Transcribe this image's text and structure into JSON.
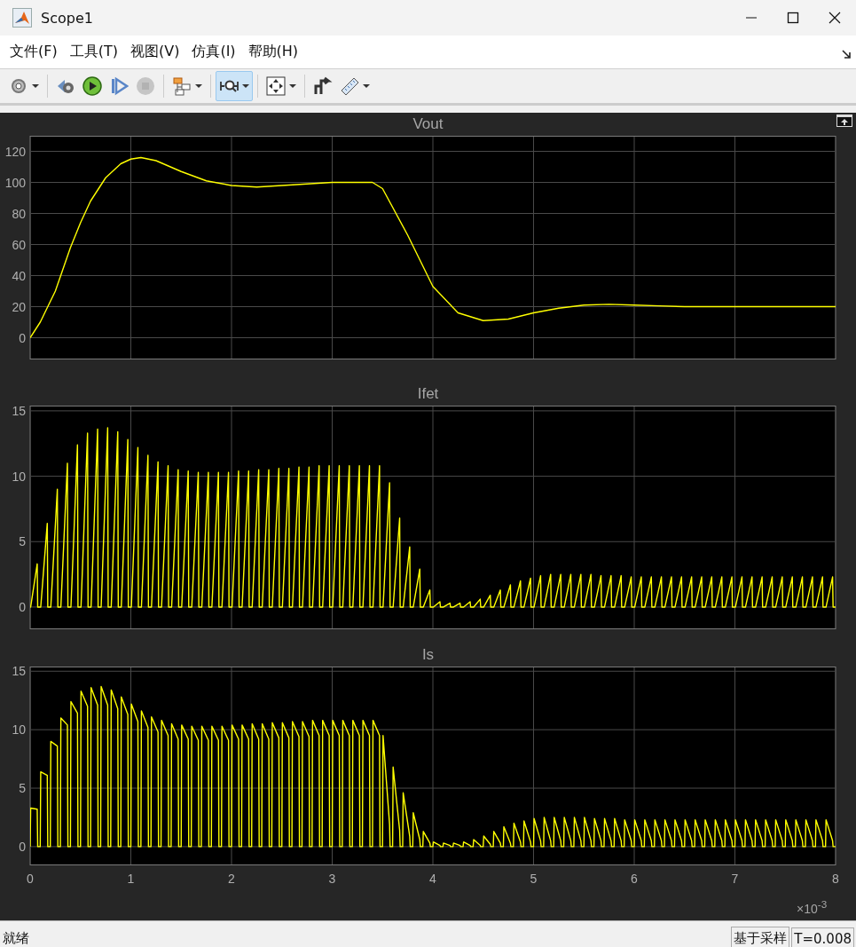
{
  "window": {
    "title": "Scope1"
  },
  "menu": [
    {
      "label": "文件(F)"
    },
    {
      "label": "工具(T)"
    },
    {
      "label": "视图(V)"
    },
    {
      "label": "仿真(I)"
    },
    {
      "label": "帮助(H)"
    }
  ],
  "toolbar": [
    {
      "kind": "settings",
      "selected": false,
      "disabled": false,
      "has_menu": true
    },
    {
      "kind": "step-back",
      "selected": false,
      "disabled": false,
      "has_menu": false
    },
    {
      "kind": "run",
      "selected": false,
      "disabled": false,
      "has_menu": false
    },
    {
      "kind": "step-forward",
      "selected": false,
      "disabled": false,
      "has_menu": false
    },
    {
      "kind": "stop",
      "selected": false,
      "disabled": true,
      "has_menu": false
    },
    {
      "kind": "signals",
      "selected": false,
      "disabled": false,
      "has_menu": true
    },
    {
      "kind": "zoom-x",
      "selected": true,
      "disabled": false,
      "has_menu": true
    },
    {
      "kind": "fit",
      "selected": false,
      "disabled": false,
      "has_menu": true
    },
    {
      "kind": "triggers",
      "selected": false,
      "disabled": false,
      "has_menu": false
    },
    {
      "kind": "measure",
      "selected": false,
      "disabled": false,
      "has_menu": true
    }
  ],
  "scope": {
    "panels": [
      {
        "chart_data": {
          "type": "line",
          "grid": true,
          "title": "Vout",
          "xlim": [
            0,
            8
          ],
          "ylim": [
            -14,
            130
          ],
          "yticks": [
            0,
            20,
            40,
            60,
            80,
            100,
            120
          ],
          "x": [
            0,
            0.1,
            0.25,
            0.4,
            0.5,
            0.6,
            0.75,
            0.9,
            1,
            1.1,
            1.25,
            1.5,
            1.75,
            2,
            2.25,
            2.5,
            2.75,
            3,
            3.25,
            3.4,
            3.5,
            3.75,
            4,
            4.25,
            4.5,
            4.75,
            5,
            5.25,
            5.5,
            5.75,
            6,
            6.25,
            6.5,
            6.75,
            7,
            7.25,
            7.5,
            7.75,
            8
          ],
          "series": [
            {
              "color": "#ffff00",
              "values": [
                0,
                10,
                30,
                58,
                74,
                88,
                103,
                112,
                115,
                116,
                114,
                107,
                101,
                98,
                97,
                98,
                99,
                100,
                100,
                100,
                96,
                66,
                33,
                16,
                11,
                12,
                16,
                19,
                21,
                21.5,
                21,
                20.5,
                20,
                20,
                20,
                20,
                20,
                20,
                20
              ]
            }
          ]
        }
      },
      {
        "chart_data": {
          "type": "line",
          "grid": true,
          "title": "Ifet",
          "xlim": [
            0,
            8
          ],
          "ylim": [
            -1.7,
            15.4
          ],
          "yticks": [
            0,
            5,
            10,
            15
          ],
          "x": [
            0,
            0.005,
            0.07,
            0.075,
            0.1,
            0.105,
            0.17,
            0.175,
            0.2,
            0.205,
            0.27,
            0.275,
            0.3,
            0.305,
            0.37,
            0.375,
            0.4,
            0.405,
            0.47,
            0.475,
            0.5,
            0.505,
            0.57,
            0.575,
            0.6,
            0.605,
            0.67,
            0.675,
            0.7,
            0.705,
            0.77,
            0.775,
            0.8,
            0.805,
            0.87,
            0.875,
            0.9,
            0.905,
            0.97,
            0.975,
            1,
            1.005,
            1.07,
            1.075,
            1.1,
            1.105,
            1.17,
            1.175,
            1.2,
            1.205,
            1.27,
            1.275,
            1.3,
            1.305,
            1.37,
            1.375,
            1.4,
            1.405,
            1.47,
            1.475,
            1.5,
            1.505,
            1.57,
            1.575,
            1.6,
            1.605,
            1.67,
            1.675,
            1.7,
            1.705,
            1.77,
            1.775,
            1.8,
            1.805,
            1.87,
            1.875,
            1.9,
            1.905,
            1.97,
            1.975,
            2,
            2.005,
            2.07,
            2.075,
            2.1,
            2.105,
            2.17,
            2.175,
            2.2,
            2.205,
            2.27,
            2.275,
            2.3,
            2.305,
            2.37,
            2.375,
            2.4,
            2.405,
            2.47,
            2.475,
            2.5,
            2.505,
            2.57,
            2.575,
            2.6,
            2.605,
            2.67,
            2.675,
            2.7,
            2.705,
            2.77,
            2.775,
            2.8,
            2.805,
            2.87,
            2.875,
            2.9,
            2.905,
            2.97,
            2.975,
            3,
            3.005,
            3.07,
            3.075,
            3.1,
            3.105,
            3.17,
            3.175,
            3.2,
            3.205,
            3.27,
            3.275,
            3.3,
            3.305,
            3.37,
            3.375,
            3.4,
            3.405,
            3.47,
            3.475,
            3.5,
            3.505,
            3.57,
            3.575,
            3.6,
            3.605,
            3.67,
            3.675,
            3.7,
            3.705,
            3.77,
            3.775,
            3.8,
            3.805,
            3.87,
            3.875,
            3.9,
            3.905,
            3.97,
            3.975,
            4,
            4.005,
            4.07,
            4.075,
            4.1,
            4.105,
            4.17,
            4.175,
            4.2,
            4.205,
            4.27,
            4.275,
            4.3,
            4.305,
            4.37,
            4.375,
            4.4,
            4.405,
            4.47,
            4.475,
            4.5,
            4.505,
            4.57,
            4.575,
            4.6,
            4.605,
            4.67,
            4.675,
            4.7,
            4.705,
            4.77,
            4.775,
            4.8,
            4.805,
            4.87,
            4.875,
            4.9,
            4.905,
            4.97,
            4.975,
            5,
            5.005,
            5.07,
            5.075,
            5.1,
            5.105,
            5.17,
            5.175,
            5.2,
            5.205,
            5.27,
            5.275,
            5.3,
            5.305,
            5.37,
            5.375,
            5.4,
            5.405,
            5.47,
            5.475,
            5.5,
            5.505,
            5.57,
            5.575,
            5.6,
            5.605,
            5.67,
            5.675,
            5.7,
            5.705,
            5.77,
            5.775,
            5.8,
            5.805,
            5.87,
            5.875,
            5.9,
            5.905,
            5.97,
            5.975,
            6,
            6.005,
            6.07,
            6.075,
            6.1,
            6.105,
            6.17,
            6.175,
            6.2,
            6.205,
            6.27,
            6.275,
            6.3,
            6.305,
            6.37,
            6.375,
            6.4,
            6.405,
            6.47,
            6.475,
            6.5,
            6.505,
            6.57,
            6.575,
            6.6,
            6.605,
            6.67,
            6.675,
            6.7,
            6.705,
            6.77,
            6.775,
            6.8,
            6.805,
            6.87,
            6.875,
            6.9,
            6.905,
            6.97,
            6.975,
            7,
            7.005,
            7.07,
            7.075,
            7.1,
            7.105,
            7.17,
            7.175,
            7.2,
            7.205,
            7.27,
            7.275,
            7.3,
            7.305,
            7.37,
            7.375,
            7.4,
            7.405,
            7.47,
            7.475,
            7.5,
            7.505,
            7.57,
            7.575,
            7.6,
            7.605,
            7.67,
            7.675,
            7.7,
            7.705,
            7.77,
            7.775,
            7.8,
            7.805,
            7.87,
            7.875,
            7.9,
            7.905,
            7.97,
            7.975,
            8
          ],
          "series": [
            {
              "color": "#ffff00",
              "values": [
                0,
                0,
                3.3,
                0,
                0,
                0,
                6.4,
                0,
                0,
                0,
                9.0,
                0,
                0,
                0,
                11.0,
                0,
                0,
                0,
                12.4,
                0,
                0,
                0,
                13.3,
                0,
                0,
                0,
                13.6,
                0,
                0,
                0,
                13.7,
                0,
                0,
                0,
                13.4,
                0,
                0,
                0,
                12.8,
                0,
                0,
                0,
                12.2,
                0,
                0,
                0,
                11.6,
                0,
                0,
                0,
                11.1,
                0,
                0,
                0,
                10.8,
                0,
                0,
                0,
                10.5,
                0,
                0,
                0,
                10.4,
                0,
                0,
                0,
                10.3,
                0,
                0,
                0,
                10.3,
                0,
                0,
                0,
                10.3,
                0,
                0,
                0,
                10.3,
                0,
                0,
                0,
                10.4,
                0,
                0,
                0,
                10.4,
                0,
                0,
                0,
                10.5,
                0,
                0,
                0,
                10.5,
                0,
                0,
                0,
                10.6,
                0,
                0,
                0,
                10.6,
                0,
                0,
                0,
                10.7,
                0,
                0,
                0,
                10.7,
                0,
                0,
                0,
                10.8,
                0,
                0,
                0,
                10.8,
                0,
                0,
                0,
                10.8,
                0,
                0,
                0,
                10.8,
                0,
                0,
                0,
                10.8,
                0,
                0,
                0,
                10.8,
                0,
                0,
                0,
                10.8,
                0,
                0,
                0,
                9.5,
                0,
                0,
                0,
                6.8,
                0,
                0,
                0,
                4.6,
                0,
                0,
                0,
                2.9,
                0,
                0,
                0,
                1.3,
                0,
                0,
                0,
                0.4,
                0,
                0,
                0,
                0.3,
                0,
                0,
                0,
                0.3,
                0,
                0,
                0,
                0.4,
                0,
                0,
                0,
                0.6,
                0,
                0,
                0,
                0.9,
                0,
                0,
                0,
                1.3,
                0,
                0,
                0,
                1.7,
                0,
                0,
                0,
                2.0,
                0,
                0,
                0,
                2.2,
                0,
                0,
                0,
                2.4,
                0,
                0,
                0,
                2.5,
                0,
                0,
                0,
                2.5,
                0,
                0,
                0,
                2.5,
                0,
                0,
                0,
                2.5,
                0,
                0,
                0,
                2.5,
                0,
                0,
                0,
                2.4,
                0,
                0,
                0,
                2.4,
                0,
                0,
                0,
                2.4,
                0,
                0,
                0,
                2.3,
                0,
                0,
                0,
                2.3,
                0,
                0,
                0,
                2.3,
                0,
                0,
                0,
                2.3,
                0,
                0,
                0,
                2.3,
                0,
                0,
                0,
                2.3,
                0,
                0,
                0,
                2.3,
                0,
                0,
                0,
                2.3,
                0,
                0,
                0,
                2.3,
                0,
                0,
                0,
                2.3,
                0,
                0,
                0,
                2.3,
                0,
                0,
                0,
                2.3,
                0,
                0,
                0,
                2.3,
                0,
                0,
                0,
                2.3,
                0,
                0,
                0,
                2.3,
                0,
                0,
                0,
                2.3,
                0,
                0,
                0,
                2.3,
                0,
                0,
                0,
                2.3,
                0,
                0,
                0,
                2.3,
                0,
                0,
                0,
                2.3,
                0,
                0,
                0,
                2.3,
                0,
                0
              ]
            }
          ]
        }
      },
      {
        "chart_data": {
          "type": "line",
          "grid": true,
          "title": "Is",
          "xlim": [
            0,
            8
          ],
          "ylim": [
            -1.6,
            15.4
          ],
          "yticks": [
            0,
            5,
            10,
            15
          ],
          "xticks": [
            0,
            1,
            2,
            3,
            4,
            5,
            6,
            7,
            8
          ],
          "x": [
            0,
            0.005,
            0.07,
            0.075,
            0.1,
            0.105,
            0.17,
            0.175,
            0.2,
            0.205,
            0.27,
            0.275,
            0.3,
            0.305,
            0.37,
            0.375,
            0.4,
            0.405,
            0.47,
            0.475,
            0.5,
            0.505,
            0.57,
            0.575,
            0.6,
            0.605,
            0.67,
            0.675,
            0.7,
            0.705,
            0.77,
            0.775,
            0.8,
            0.805,
            0.87,
            0.875,
            0.9,
            0.905,
            0.97,
            0.975,
            1,
            1.005,
            1.07,
            1.075,
            1.1,
            1.105,
            1.17,
            1.175,
            1.2,
            1.205,
            1.27,
            1.275,
            1.3,
            1.305,
            1.37,
            1.375,
            1.4,
            1.405,
            1.47,
            1.475,
            1.5,
            1.505,
            1.57,
            1.575,
            1.6,
            1.605,
            1.67,
            1.675,
            1.7,
            1.705,
            1.77,
            1.775,
            1.8,
            1.805,
            1.87,
            1.875,
            1.9,
            1.905,
            1.97,
            1.975,
            2,
            2.005,
            2.07,
            2.075,
            2.1,
            2.105,
            2.17,
            2.175,
            2.2,
            2.205,
            2.27,
            2.275,
            2.3,
            2.305,
            2.37,
            2.375,
            2.4,
            2.405,
            2.47,
            2.475,
            2.5,
            2.505,
            2.57,
            2.575,
            2.6,
            2.605,
            2.67,
            2.675,
            2.7,
            2.705,
            2.77,
            2.775,
            2.8,
            2.805,
            2.87,
            2.875,
            2.9,
            2.905,
            2.97,
            2.975,
            3,
            3.005,
            3.07,
            3.075,
            3.1,
            3.105,
            3.17,
            3.175,
            3.2,
            3.205,
            3.27,
            3.275,
            3.3,
            3.305,
            3.37,
            3.375,
            3.4,
            3.405,
            3.47,
            3.475,
            3.5,
            3.505,
            3.57,
            3.575,
            3.6,
            3.605,
            3.67,
            3.675,
            3.7,
            3.705,
            3.77,
            3.775,
            3.8,
            3.805,
            3.87,
            3.875,
            3.9,
            3.905,
            3.97,
            3.975,
            4,
            4.005,
            4.07,
            4.075,
            4.1,
            4.105,
            4.17,
            4.175,
            4.2,
            4.205,
            4.27,
            4.275,
            4.3,
            4.305,
            4.37,
            4.375,
            4.4,
            4.405,
            4.47,
            4.475,
            4.5,
            4.505,
            4.57,
            4.575,
            4.6,
            4.605,
            4.67,
            4.675,
            4.7,
            4.705,
            4.77,
            4.775,
            4.8,
            4.805,
            4.87,
            4.875,
            4.9,
            4.905,
            4.97,
            4.975,
            5,
            5.005,
            5.07,
            5.075,
            5.1,
            5.105,
            5.17,
            5.175,
            5.2,
            5.205,
            5.27,
            5.275,
            5.3,
            5.305,
            5.37,
            5.375,
            5.4,
            5.405,
            5.47,
            5.475,
            5.5,
            5.505,
            5.57,
            5.575,
            5.6,
            5.605,
            5.67,
            5.675,
            5.7,
            5.705,
            5.77,
            5.775,
            5.8,
            5.805,
            5.87,
            5.875,
            5.9,
            5.905,
            5.97,
            5.975,
            6,
            6.005,
            6.07,
            6.075,
            6.1,
            6.105,
            6.17,
            6.175,
            6.2,
            6.205,
            6.27,
            6.275,
            6.3,
            6.305,
            6.37,
            6.375,
            6.4,
            6.405,
            6.47,
            6.475,
            6.5,
            6.505,
            6.57,
            6.575,
            6.6,
            6.605,
            6.67,
            6.675,
            6.7,
            6.705,
            6.77,
            6.775,
            6.8,
            6.805,
            6.87,
            6.875,
            6.9,
            6.905,
            6.97,
            6.975,
            7,
            7.005,
            7.07,
            7.075,
            7.1,
            7.105,
            7.17,
            7.175,
            7.2,
            7.205,
            7.27,
            7.275,
            7.3,
            7.305,
            7.37,
            7.375,
            7.4,
            7.405,
            7.47,
            7.475,
            7.5,
            7.505,
            7.57,
            7.575,
            7.6,
            7.605,
            7.67,
            7.675,
            7.7,
            7.705,
            7.77,
            7.775,
            7.8,
            7.805,
            7.87,
            7.875,
            7.9,
            7.905,
            7.97,
            7.975,
            8
          ],
          "series": [
            {
              "color": "#ffff00",
              "values": [
                0,
                3.3,
                3.2,
                0,
                0,
                6.4,
                6.1,
                0,
                0,
                9.0,
                8.6,
                0,
                0,
                11.0,
                10.4,
                0,
                0,
                12.4,
                11.4,
                0,
                0,
                13.3,
                12.0,
                0,
                0,
                13.6,
                12.1,
                0,
                0,
                13.7,
                12.1,
                0,
                0,
                13.4,
                11.8,
                0,
                0,
                12.8,
                11.3,
                0,
                0,
                12.2,
                10.7,
                0,
                0,
                11.6,
                10.2,
                0,
                0,
                11.1,
                9.8,
                0,
                0,
                10.8,
                9.5,
                0,
                0,
                10.5,
                9.2,
                0,
                0,
                10.4,
                9.2,
                0,
                0,
                10.3,
                9.1,
                0,
                0,
                10.3,
                9.1,
                0,
                0,
                10.3,
                9.1,
                0,
                0,
                10.3,
                9.1,
                0,
                0,
                10.4,
                9.2,
                0,
                0,
                10.4,
                9.2,
                0,
                0,
                10.5,
                9.2,
                0,
                0,
                10.5,
                9.2,
                0,
                0,
                10.6,
                9.3,
                0,
                0,
                10.6,
                9.3,
                0,
                0,
                10.7,
                9.4,
                0,
                0,
                10.7,
                9.4,
                0,
                0,
                10.8,
                9.5,
                0,
                0,
                10.8,
                9.5,
                0,
                0,
                10.8,
                9.5,
                0,
                0,
                10.8,
                9.5,
                0,
                0,
                10.8,
                9.5,
                0,
                0,
                10.8,
                9.5,
                0,
                0,
                10.8,
                9.5,
                0,
                0,
                9.5,
                1.9,
                0,
                0,
                6.8,
                1.4,
                0,
                0,
                4.6,
                0.9,
                0,
                0,
                2.9,
                0.6,
                0,
                0,
                1.3,
                0.3,
                0,
                0,
                0.4,
                0.1,
                0,
                0,
                0.3,
                0.1,
                0,
                0,
                0.3,
                0.1,
                0,
                0,
                0.4,
                0.1,
                0,
                0,
                0.6,
                0.1,
                0,
                0,
                0.9,
                0.2,
                0,
                0,
                1.3,
                0.3,
                0,
                0,
                1.7,
                0.3,
                0,
                0,
                2.0,
                0.4,
                0,
                0,
                2.2,
                0.4,
                0,
                0,
                2.4,
                0.5,
                0,
                0,
                2.5,
                0.5,
                0,
                0,
                2.5,
                0.5,
                0,
                0,
                2.5,
                0.5,
                0,
                0,
                2.5,
                0.5,
                0,
                0,
                2.5,
                0.5,
                0,
                0,
                2.4,
                0.5,
                0,
                0,
                2.4,
                0.5,
                0,
                0,
                2.4,
                0.5,
                0,
                0,
                2.3,
                0.5,
                0,
                0,
                2.3,
                0.5,
                0,
                0,
                2.3,
                0.5,
                0,
                0,
                2.3,
                0.5,
                0,
                0,
                2.3,
                0.5,
                0,
                0,
                2.3,
                0.5,
                0,
                0,
                2.3,
                0.5,
                0,
                0,
                2.3,
                0.5,
                0,
                0,
                2.3,
                0.5,
                0,
                0,
                2.3,
                0.5,
                0,
                0,
                2.3,
                0.5,
                0,
                0,
                2.3,
                0.5,
                0,
                0,
                2.3,
                0.5,
                0,
                0,
                2.3,
                0.5,
                0,
                0,
                2.3,
                0.5,
                0,
                0,
                2.3,
                0.5,
                0,
                0,
                2.3,
                0.5,
                0,
                0,
                2.3,
                0.5,
                0,
                0,
                2.3,
                0.5,
                0,
                0,
                2.3,
                0.5,
                0,
                0,
                2.3,
                0.5,
                0,
                0
              ]
            }
          ]
        },
        "x_multiplier": "×10$^{-3}$"
      }
    ]
  },
  "status_bar": {
    "status": "就绪",
    "mode": "基于采样",
    "time": "T=0.008"
  }
}
